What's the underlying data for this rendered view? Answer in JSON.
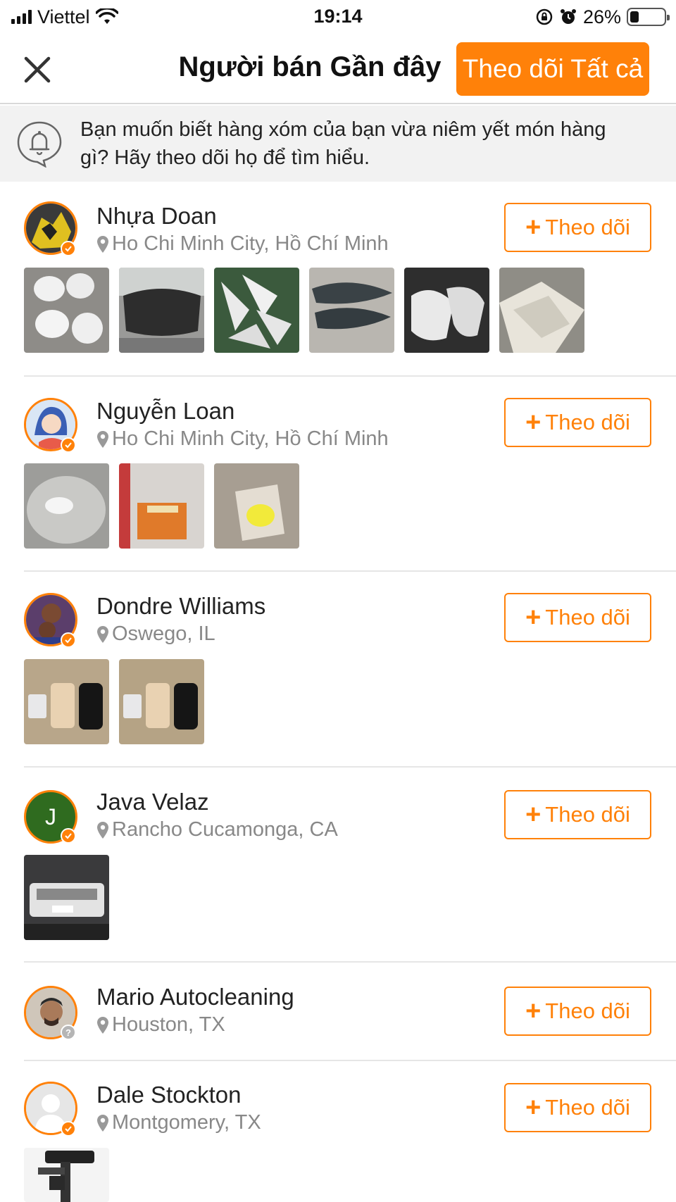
{
  "status_bar": {
    "carrier": "Viettel",
    "time": "19:14",
    "battery": "26%",
    "battery_level": 0.26
  },
  "header": {
    "title": "Người bán Gần đây",
    "follow_all_label": "Theo dõi Tất cả"
  },
  "banner": {
    "text_line1": "Bạn muốn biết hàng xóm của bạn vừa niêm yết món hàng",
    "text_line2": "gì? Hãy theo dõi họ để tìm hiểu."
  },
  "follow_label": "Theo dõi",
  "sellers": [
    {
      "name": "Nhựa Doan",
      "location": "Ho Chi Minh City, Hồ Chí Minh",
      "listing_count": 6
    },
    {
      "name": "Nguyễn Loan",
      "location": "Ho Chi Minh City, Hồ Chí Minh",
      "listing_count": 3
    },
    {
      "name": "Dondre Williams",
      "location": "Oswego, IL",
      "listing_count": 2
    },
    {
      "name": "Java Velaz",
      "location": "Rancho Cucamonga, CA",
      "avatar_initial": "J",
      "listing_count": 1
    },
    {
      "name": "Mario Autocleaning",
      "location": "Houston, TX",
      "listing_count": 0
    },
    {
      "name": "Dale Stockton",
      "location": "Montgomery, TX",
      "listing_count": 1
    }
  ],
  "colors": {
    "accent": "#ff8109",
    "banner_bg": "#f2f2f2",
    "muted_text": "#888888",
    "divider": "#e6e6e6"
  }
}
